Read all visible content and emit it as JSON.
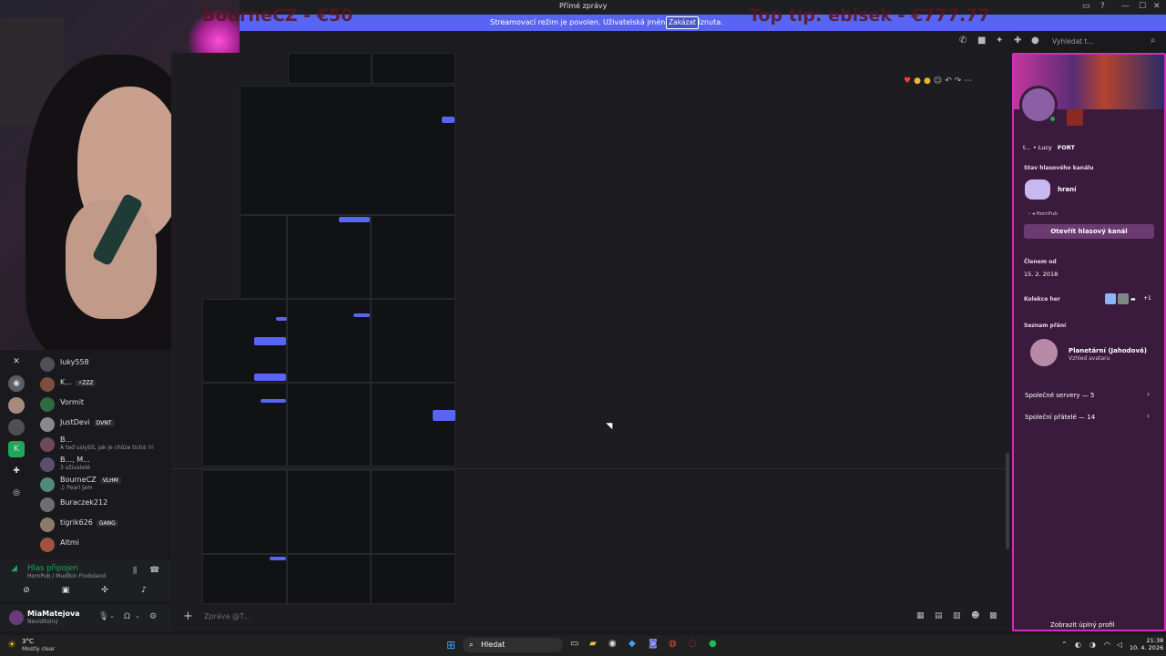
{
  "window": {
    "title": "Přímé zprávy"
  },
  "overlay": {
    "left_text": "BourneCZ - €50",
    "right_text": "Top tip: ebisek - €777.77"
  },
  "banner": {
    "message": "Streamovací režim je povolen. Uživatelská jména byla očíznuta.",
    "button_label": "Zakázat"
  },
  "toolbar": {
    "search_placeholder": "Vyhledat t..."
  },
  "members": [
    {
      "name": "luky558",
      "sub": "",
      "tag": ""
    },
    {
      "name": "K...",
      "sub": "",
      "tag": "⚡ZZZ"
    },
    {
      "name": "Vormit",
      "sub": "",
      "tag": ""
    },
    {
      "name": "JustDevi",
      "sub": "",
      "tag": "DVNT"
    },
    {
      "name": "B...",
      "sub": "A teď uslyšíš, jak je chůze tichá !!!",
      "tag": ""
    },
    {
      "name": "B..., M...",
      "sub": "3 uživatelé",
      "tag": ""
    },
    {
      "name": "BourneCZ",
      "sub": "♫ Pearl Jam",
      "tag": "VLHM"
    },
    {
      "name": "Buraczek212",
      "sub": "",
      "tag": ""
    },
    {
      "name": "tigrik626",
      "sub": "",
      "tag": "GANG"
    },
    {
      "name": "Altmi",
      "sub": "",
      "tag": ""
    }
  ],
  "voice": {
    "status": "Hlas připojen",
    "channel": "HornPub / Mudlkin Frodoland"
  },
  "user": {
    "name": "MiaMatejova",
    "status": "Neviditelný"
  },
  "composer": {
    "placeholder": "Zpráva @T..."
  },
  "profile": {
    "username": "t... • Lucy",
    "guild_tag": "FORT",
    "voice_section_title": "Stav hlasového kanálu",
    "voice_activity": "hraní",
    "voice_channel": "HornPub",
    "open_voice_label": "Otevřít hlasový kanál",
    "member_since_title": "Členem od",
    "member_since": "15. 2. 2018",
    "collection_title": "Kolekce her",
    "collection_more": "+1",
    "wishlist_title": "Seznam přání",
    "wishlist_item": "Planetární (Jahodová)",
    "wishlist_sub": "Vzhled avataru",
    "mutual_servers": "Společné servery — 5",
    "mutual_friends": "Společní přátelé — 14",
    "full_profile": "Zobrazit úplný profil"
  },
  "taskbar": {
    "weather_temp": "3°C",
    "weather_desc": "Mostly clear",
    "search_label": "Hledat",
    "time": "21:38",
    "date": "10. 4. 2026"
  },
  "colors": {
    "accent": "#5865f2",
    "profile_border": "#d32dbd",
    "online": "#23a55a"
  }
}
